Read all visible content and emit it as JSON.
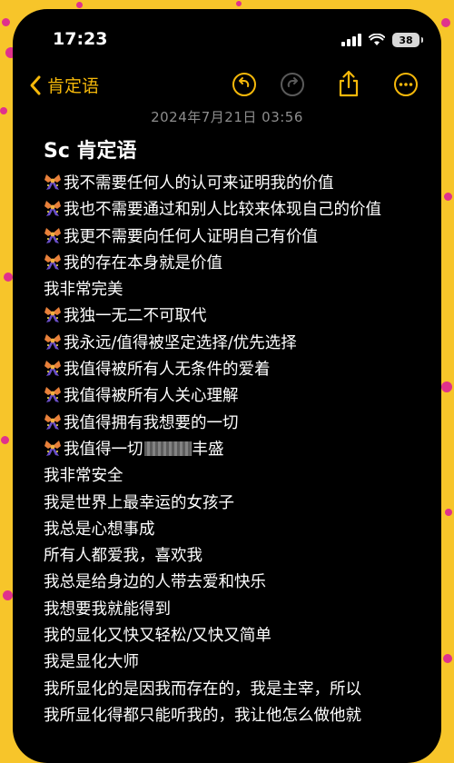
{
  "status_bar": {
    "time": "17:23",
    "battery": "38"
  },
  "toolbar": {
    "back_label": "肯定语"
  },
  "note": {
    "date": "2024年7月21日 03:56",
    "title": "Sc 肯定语",
    "lines": [
      {
        "emoji": "ribbon-icon",
        "text": "我不需要任何人的认可来证明我的价值"
      },
      {
        "emoji": "ribbon-icon",
        "text": "我也不需要通过和别人比较来体现自己的价值"
      },
      {
        "emoji": "ribbon-icon",
        "text": "我更不需要向任何人证明自己有价值"
      },
      {
        "emoji": "ribbon-icon",
        "text": "我的存在本身就是价值"
      },
      {
        "emoji": "",
        "text": "我非常完美"
      },
      {
        "emoji": "ribbon-icon",
        "text": "我独一无二不可取代"
      },
      {
        "emoji": "ribbon-icon",
        "text": "我永远/值得被坚定选择/优先选择"
      },
      {
        "emoji": "ribbon-icon",
        "text": "我值得被所有人无条件的爱着"
      },
      {
        "emoji": "ribbon-icon",
        "text": "我值得被所有人关心理解"
      },
      {
        "emoji": "ribbon-icon",
        "text": "我值得拥有我想要的一切"
      },
      {
        "emoji": "ribbon-icon",
        "text": "我值得一切",
        "blurred": true,
        "text_after": "丰盛"
      },
      {
        "emoji": "",
        "text": "我非常安全"
      },
      {
        "emoji": "",
        "text": "我是世界上最幸运的女孩子"
      },
      {
        "emoji": "",
        "text": "我总是心想事成"
      },
      {
        "emoji": "",
        "text": "所有人都爱我，喜欢我"
      },
      {
        "emoji": "",
        "text": "我总是给身边的人带去爱和快乐"
      },
      {
        "emoji": "",
        "text": "我想要我就能得到"
      },
      {
        "emoji": "",
        "text": "我的显化又快又轻松/又快又简单"
      },
      {
        "emoji": "",
        "text": "我是显化大师"
      },
      {
        "emoji": "",
        "text": "我所显化的是因我而存在的，我是主宰，所以"
      },
      {
        "emoji": "",
        "text": "我所显化得都只能听我的，我让他怎么做他就"
      }
    ]
  },
  "colors": {
    "accent": "#f5b80a",
    "background": "#000000",
    "frame": "#f7c52a"
  }
}
